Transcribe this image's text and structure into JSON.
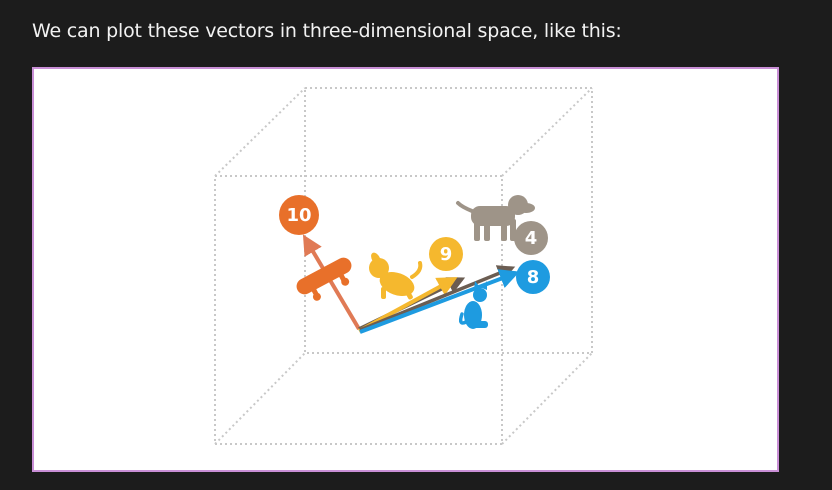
{
  "intro_text": "We can plot these vectors in three-dimensional space, like this:",
  "colors": {
    "page_background": "#1c1c1c",
    "frame_border": "#c98fd6",
    "cube_lines": "#c8c8c8",
    "skateboard": "#e8702a",
    "skateboard_vector": "#e07a55",
    "puppy": "#f5b82e",
    "dog": "#9e9488",
    "dog_vector": "#6b5d52",
    "cat": "#1e9be0"
  },
  "vectors": [
    {
      "item": "skateboard",
      "label": "10",
      "icon": "skateboard-icon"
    },
    {
      "item": "puppy",
      "label": "9",
      "icon": "puppy-icon"
    },
    {
      "item": "dog",
      "label": "4",
      "icon": "dog-icon"
    },
    {
      "item": "cat",
      "label": "8",
      "icon": "cat-icon"
    }
  ]
}
